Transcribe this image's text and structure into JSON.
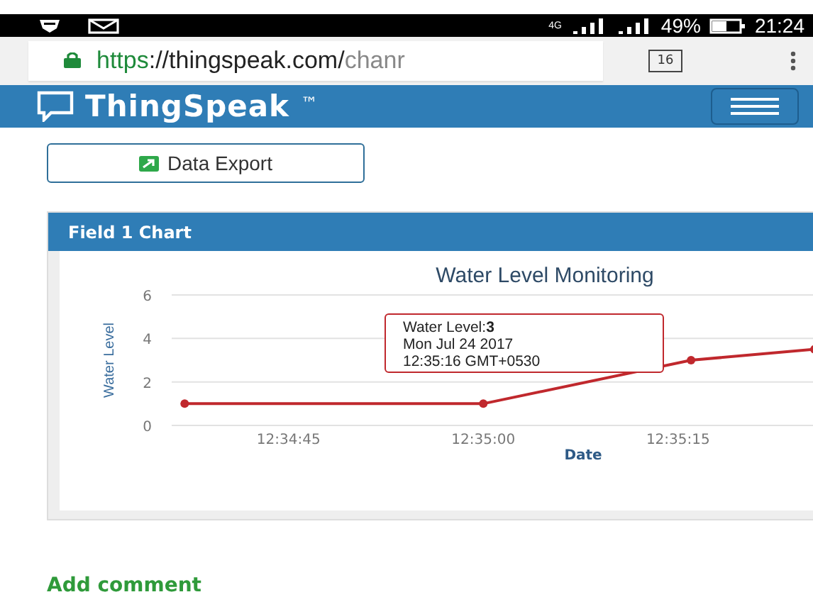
{
  "status_bar": {
    "network": "4G",
    "battery": "49%",
    "time": "21:24"
  },
  "browser": {
    "url": {
      "scheme": "https",
      "host": "://thingspeak.com/",
      "path": "chanr"
    },
    "tab_count": "16"
  },
  "navbar": {
    "brand": "ThingSpeak",
    "trademark": "™"
  },
  "export_button": {
    "label": "Data Export"
  },
  "panel": {
    "title": "Field 1 Chart",
    "chart_data": {
      "type": "line",
      "title": "Water Level Monitoring",
      "xlabel": "Date",
      "ylabel": "Water Level",
      "x": [
        45277,
        45300,
        45316,
        45325.5
      ],
      "xlim": [
        45276,
        45325.5
      ],
      "ylim": [
        0,
        6
      ],
      "xticks": [
        {
          "value": 45285,
          "label": "12:34:45"
        },
        {
          "value": 45300,
          "label": "12:35:00"
        },
        {
          "value": 45315,
          "label": "12:35:15"
        }
      ],
      "yticks": [
        0,
        2,
        4,
        6
      ],
      "series": [
        {
          "marker": "circle",
          "color": "#c0282d",
          "values": [
            1,
            1,
            3,
            3.5
          ]
        }
      ]
    },
    "tooltip": [
      "Water Level:**3**",
      "Mon Jul 24 2017",
      "12:35:16 GMT+0530"
    ]
  },
  "add_comment": "Add comment"
}
